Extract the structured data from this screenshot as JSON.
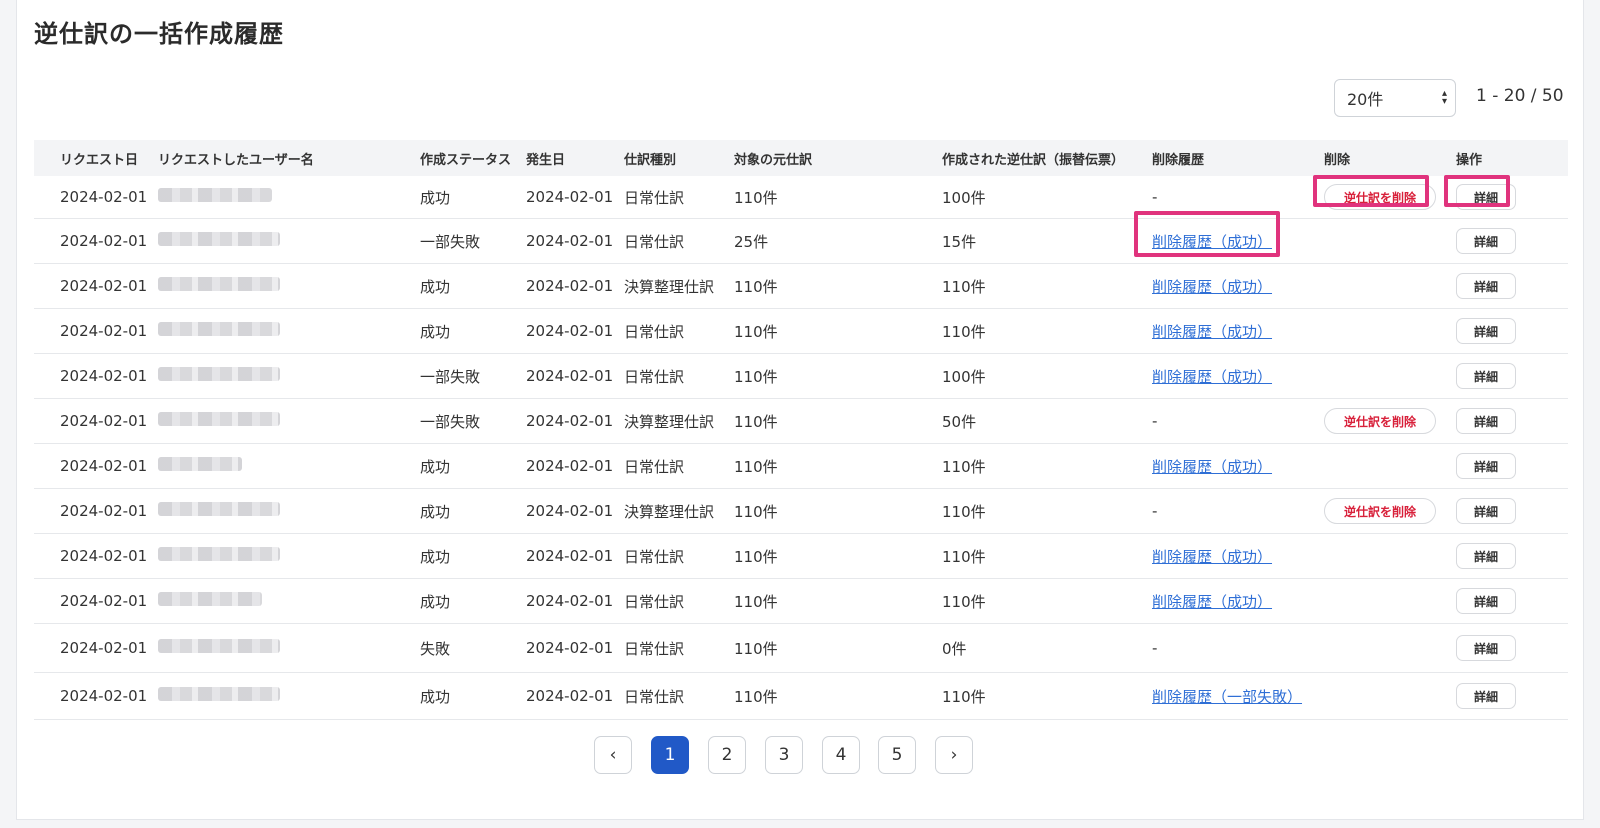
{
  "page": {
    "title": "逆仕訳の一括作成履歴",
    "per_page": "20件",
    "range": "1 - 20 / 50"
  },
  "columns": {
    "request_date": "リクエスト日",
    "user_name": "リクエストしたユーザー名",
    "status": "作成ステータス",
    "occurred": "発生日",
    "journal_type": "仕訳種別",
    "target": "対象の元仕訳",
    "created": "作成された逆仕訳（振替伝票）",
    "delete_history": "削除履歴",
    "delete": "削除",
    "ops": "操作"
  },
  "labels": {
    "delete_button": "逆仕訳を削除",
    "detail_button": "詳細"
  },
  "rows": [
    {
      "date": "2024-02-01",
      "status": "成功",
      "occurred": "2024-02-01",
      "type": "日常仕訳",
      "target": "110件",
      "created": "100件",
      "history": "-",
      "history_link": false,
      "delete": true
    },
    {
      "date": "2024-02-01",
      "status": "一部失敗",
      "occurred": "2024-02-01",
      "type": "日常仕訳",
      "target": "25件",
      "created": "15件",
      "history": "削除履歴（成功）",
      "history_link": true,
      "delete": false
    },
    {
      "date": "2024-02-01",
      "status": "成功",
      "occurred": "2024-02-01",
      "type": "決算整理仕訳",
      "target": "110件",
      "created": "110件",
      "history": "削除履歴（成功）",
      "history_link": true,
      "delete": false
    },
    {
      "date": "2024-02-01",
      "status": "成功",
      "occurred": "2024-02-01",
      "type": "日常仕訳",
      "target": "110件",
      "created": "110件",
      "history": "削除履歴（成功）",
      "history_link": true,
      "delete": false
    },
    {
      "date": "2024-02-01",
      "status": "一部失敗",
      "occurred": "2024-02-01",
      "type": "日常仕訳",
      "target": "110件",
      "created": "100件",
      "history": "削除履歴（成功）",
      "history_link": true,
      "delete": false
    },
    {
      "date": "2024-02-01",
      "status": "一部失敗",
      "occurred": "2024-02-01",
      "type": "決算整理仕訳",
      "target": "110件",
      "created": "50件",
      "history": "-",
      "history_link": false,
      "delete": true
    },
    {
      "date": "2024-02-01",
      "status": "成功",
      "occurred": "2024-02-01",
      "type": "日常仕訳",
      "target": "110件",
      "created": "110件",
      "history": "削除履歴（成功）",
      "history_link": true,
      "delete": false
    },
    {
      "date": "2024-02-01",
      "status": "成功",
      "occurred": "2024-02-01",
      "type": "決算整理仕訳",
      "target": "110件",
      "created": "110件",
      "history": "-",
      "history_link": false,
      "delete": true
    },
    {
      "date": "2024-02-01",
      "status": "成功",
      "occurred": "2024-02-01",
      "type": "日常仕訳",
      "target": "110件",
      "created": "110件",
      "history": "削除履歴（成功）",
      "history_link": true,
      "delete": false
    },
    {
      "date": "2024-02-01",
      "status": "成功",
      "occurred": "2024-02-01",
      "type": "日常仕訳",
      "target": "110件",
      "created": "110件",
      "history": "削除履歴（成功）",
      "history_link": true,
      "delete": false
    },
    {
      "date": "2024-02-01",
      "status": "失敗",
      "occurred": "2024-02-01",
      "type": "日常仕訳",
      "target": "110件",
      "created": "0件",
      "history": "-",
      "history_link": false,
      "delete": false
    },
    {
      "date": "2024-02-01",
      "status": "成功",
      "occurred": "2024-02-01",
      "type": "日常仕訳",
      "target": "110件",
      "created": "110件",
      "history": "削除履歴（一部失敗）",
      "history_link": true,
      "delete": false
    }
  ],
  "pagination": {
    "prev": "‹",
    "next": "›",
    "pages": [
      "1",
      "2",
      "3",
      "4",
      "5"
    ],
    "current": "1"
  },
  "colors": {
    "accent": "#2159c7",
    "link": "#2f6fd6",
    "danger": "#d8203a",
    "highlight": "#e0337d"
  }
}
